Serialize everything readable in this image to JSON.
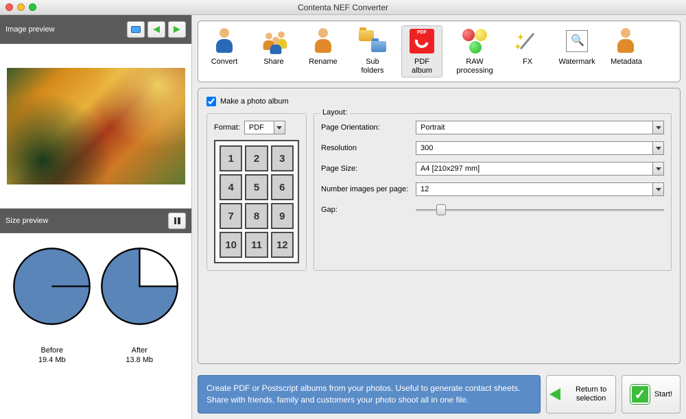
{
  "window": {
    "title": "Contenta NEF Converter"
  },
  "left": {
    "image_preview_label": "Image preview",
    "size_preview_label": "Size preview",
    "before": {
      "label": "Before",
      "value": "19.4 Mb",
      "pct": 100
    },
    "after": {
      "label": "After",
      "value": "13.8 Mb",
      "pct": 71
    }
  },
  "toolbar": {
    "items": [
      {
        "name": "convert",
        "label": "Convert"
      },
      {
        "name": "share",
        "label": "Share"
      },
      {
        "name": "rename",
        "label": "Rename"
      },
      {
        "name": "subfolders",
        "label": "Sub folders"
      },
      {
        "name": "pdf-album",
        "label": "PDF album",
        "selected": true
      },
      {
        "name": "raw",
        "label": "RAW processing"
      },
      {
        "name": "fx",
        "label": "FX"
      },
      {
        "name": "watermark",
        "label": "Watermark"
      },
      {
        "name": "metadata",
        "label": "Metadata"
      }
    ]
  },
  "settings": {
    "checkbox_label": "Make a photo album",
    "format_label": "Format:",
    "format_value": "PDF",
    "grid_cells": [
      "1",
      "2",
      "3",
      "4",
      "5",
      "6",
      "7",
      "8",
      "9",
      "10",
      "11",
      "12"
    ],
    "layout_legend": "Layout:",
    "fields": {
      "orientation": {
        "label": "Page Orientation:",
        "value": "Portrait"
      },
      "resolution": {
        "label": "Resolution",
        "value": "300"
      },
      "page_size": {
        "label": "Page Size:",
        "value": "A4 [210x297 mm]"
      },
      "num_images": {
        "label": "Number images per page:",
        "value": "12"
      },
      "gap": {
        "label": "Gap:"
      }
    }
  },
  "bottom": {
    "info": "Create PDF or Postscript albums from your photos. Useful to generate contact sheets. Share with friends, family and customers your photo shoot all in one file.",
    "return_label": "Return to selection",
    "start_label": "Start!"
  },
  "chart_data": [
    {
      "type": "pie",
      "title": "Before",
      "values": [
        100,
        0
      ],
      "colors": [
        "#5a85b8",
        "#ffffff"
      ]
    },
    {
      "type": "pie",
      "title": "After",
      "values": [
        71,
        29
      ],
      "colors": [
        "#5a85b8",
        "#ffffff"
      ]
    }
  ]
}
